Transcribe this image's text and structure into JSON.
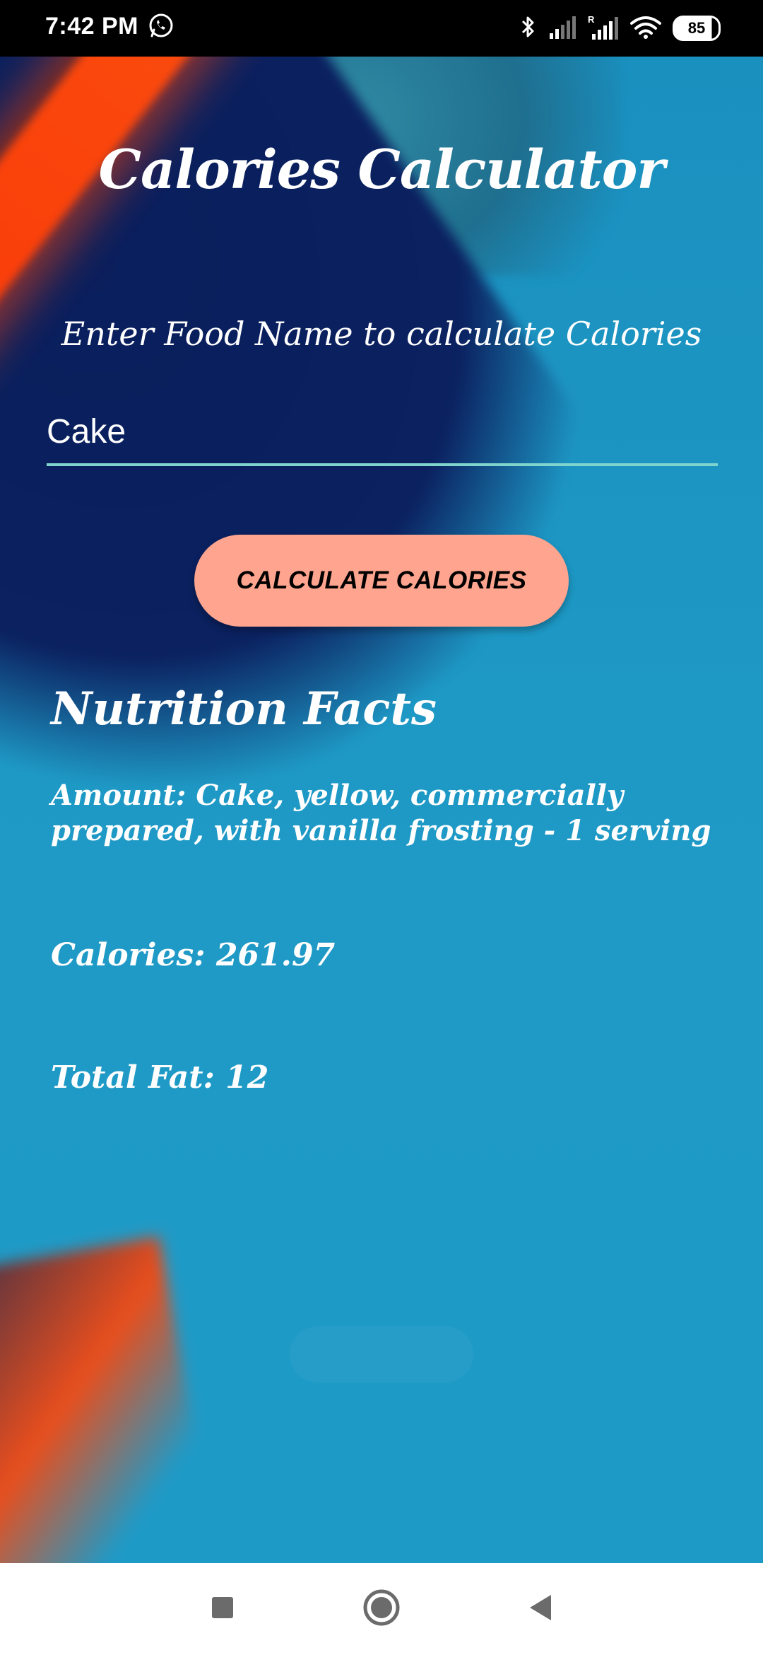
{
  "status_bar": {
    "time": "7:42 PM",
    "battery": "85",
    "icons": [
      "whatsapp-icon",
      "bluetooth-icon",
      "signal-icon",
      "signal-roaming-icon",
      "wifi-icon",
      "battery-icon"
    ]
  },
  "app": {
    "title": "Calories Calculator",
    "subtitle": "Enter Food Name to calculate Calories",
    "food_input_value": "Cake",
    "calculate_button_label": "CALCULATE CALORIES",
    "nutrition_heading": "Nutrition Facts",
    "amount_text": "Amount: Cake, yellow, commercially prepared, with vanilla frosting - 1 serving",
    "calories_text": "Calories: 261.97",
    "total_fat_text": "Total Fat: 12"
  },
  "nav_bar": {
    "buttons": [
      "recents-square-icon",
      "home-circle-icon",
      "back-triangle-icon"
    ]
  },
  "colors": {
    "accent_button": "#ffa48f",
    "input_underline": "#7fd5cd",
    "background_blue": "#1f9ac6",
    "background_orange": "#ff4a0a",
    "background_navy": "#0b2160"
  }
}
